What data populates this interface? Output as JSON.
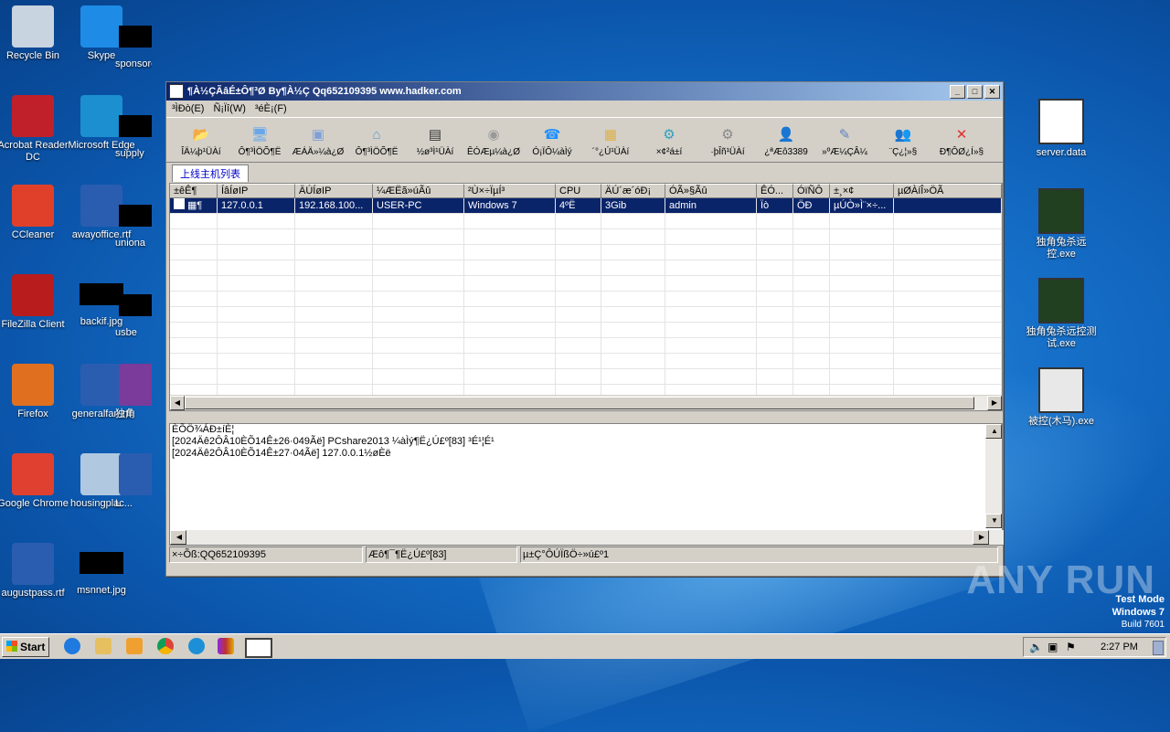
{
  "desktop": {
    "icons_left": [
      {
        "label": "Recycle Bin"
      },
      {
        "label": "Skype"
      },
      {
        "label": "sponsored..."
      },
      {
        "label": "Acrobat Reader DC"
      },
      {
        "label": "Microsoft Edge"
      },
      {
        "label": "supply"
      },
      {
        "label": "CCleaner"
      },
      {
        "label": "awayoffice.rtf"
      },
      {
        "label": "uniona"
      },
      {
        "label": "FileZilla Client"
      },
      {
        "label": "backif.jpg"
      },
      {
        "label": "usbe"
      },
      {
        "label": "Firefox"
      },
      {
        "label": "generalfan.rtf"
      },
      {
        "label": "独角"
      },
      {
        "label": "Google Chrome"
      },
      {
        "label": "housingplac..."
      },
      {
        "label": "L"
      },
      {
        "label": "augustpass.rtf"
      },
      {
        "label": "msnnet.jpg"
      }
    ],
    "icons_right": [
      {
        "label": "server.data"
      },
      {
        "label": "独角兔杀远控.exe"
      },
      {
        "label": "独角兔杀远控测试.exe"
      },
      {
        "label": "被控(木马).exe"
      }
    ],
    "watermark": "ANY RUN",
    "test_mode": {
      "line1": "Test Mode",
      "line2": "Windows 7",
      "line3": "Build 7601"
    }
  },
  "window": {
    "title": "¶À½ÇÃâÉ±Ô¶³Ø By¶À½Ç Qq652109395 www.hadker.com",
    "menu": [
      "³ÌÐò(E)",
      "Ñ¡Ïî(W)",
      "³éÈ¡(F)"
    ],
    "toolbar": [
      {
        "label": "ÎÄ¼þ¹ÜÀí",
        "icon": "folder-icon",
        "color": "#f5c542",
        "glyph": "📂"
      },
      {
        "label": "Ô¶³ÌÖÕ¶Ë",
        "icon": "monitor-icon",
        "color": "#6aa7e8",
        "glyph": "🖥"
      },
      {
        "label": "ÆÁÄ»¼à¿Ø",
        "icon": "screen-icon",
        "color": "#7f9fd6",
        "glyph": "▣"
      },
      {
        "label": "Ô¶³ÌÖÕ¶Ë",
        "icon": "network-icon",
        "color": "#5b9bd5",
        "glyph": "⌂"
      },
      {
        "label": "½ø³Ì¹ÜÀí",
        "icon": "process-icon",
        "color": "#333333",
        "glyph": "▤"
      },
      {
        "label": "ÊÓÆµ¼à¿Ø",
        "icon": "webcam-icon",
        "color": "#999999",
        "glyph": "◉"
      },
      {
        "label": "Ó¡ÏÔ¼àÌý",
        "icon": "audio-icon",
        "color": "#1e90ff",
        "glyph": "☎"
      },
      {
        "label": "´°¿Ú¹ÜÀí",
        "icon": "window-manage-icon",
        "color": "#e0b040",
        "glyph": "▦"
      },
      {
        "label": "×¢²á±í",
        "icon": "registry-icon",
        "color": "#30a0c0",
        "glyph": "⚙"
      },
      {
        "label": "·þÎñ¹ÜÀí",
        "icon": "service-icon",
        "color": "#888888",
        "glyph": "⚙"
      },
      {
        "label": "¿ªÆô3389",
        "icon": "user-icon",
        "color": "#c08040",
        "glyph": "👤"
      },
      {
        "label": "»ºÆ¼ÇÂ¼",
        "icon": "keylog-icon",
        "color": "#6080c0",
        "glyph": "✎"
      },
      {
        "label": "¨Ç¿¦»§",
        "icon": "users-icon",
        "color": "#50a050",
        "glyph": "👥"
      },
      {
        "label": "Ð¶ÔØ¿Í»§",
        "icon": "close-icon",
        "color": "#e03030",
        "glyph": "✕"
      }
    ],
    "tab": "上线主机列表",
    "columns": [
      "±êÊ¶",
      "ÍâÍøIP",
      "ÄÚÍøIP",
      "¼ÆËã»úÃû",
      "²Ù×÷ÏµÍ³",
      "CPU",
      "ÄÚ´æ´óÐ¡",
      "ÓÃ»§Ãû",
      "ÊÓ...",
      "ÓïÑÔ",
      "±¸×¢",
      "µØÀíÎ»ÖÃ"
    ],
    "rows": [
      [
        "",
        "127.0.0.1",
        "192.168.100...",
        "USER-PC",
        "Windows 7",
        "4ºË",
        "3Gib",
        "admin",
        "Ïò",
        "ÖÐ",
        "µÚÒ»Ì¨×÷...",
        ""
      ]
    ],
    "log_lines": [
      "ÈÕÖ¾ÁÐ±íÈ¦",
      "[2024Äê2ÔÂ10ÈÕ14Ê±26·049Ãë]  PCshare2013  ¼àÌý¶Ë¿Ú£º[83] ³É¹¦É¹",
      "[2024Äê2ÔÂ10ÈÕ14Ê±27·04Ãë]  127.0.0.1½øÈë"
    ],
    "status": [
      "×÷Õß:QQ652109395",
      "Æô¶¯¶Ë¿Ú£º[83]",
      "µ±Ç°ÔÚÏßÖ÷»ú£º1"
    ]
  },
  "taskbar": {
    "start": "Start",
    "time": "2:27 PM"
  }
}
